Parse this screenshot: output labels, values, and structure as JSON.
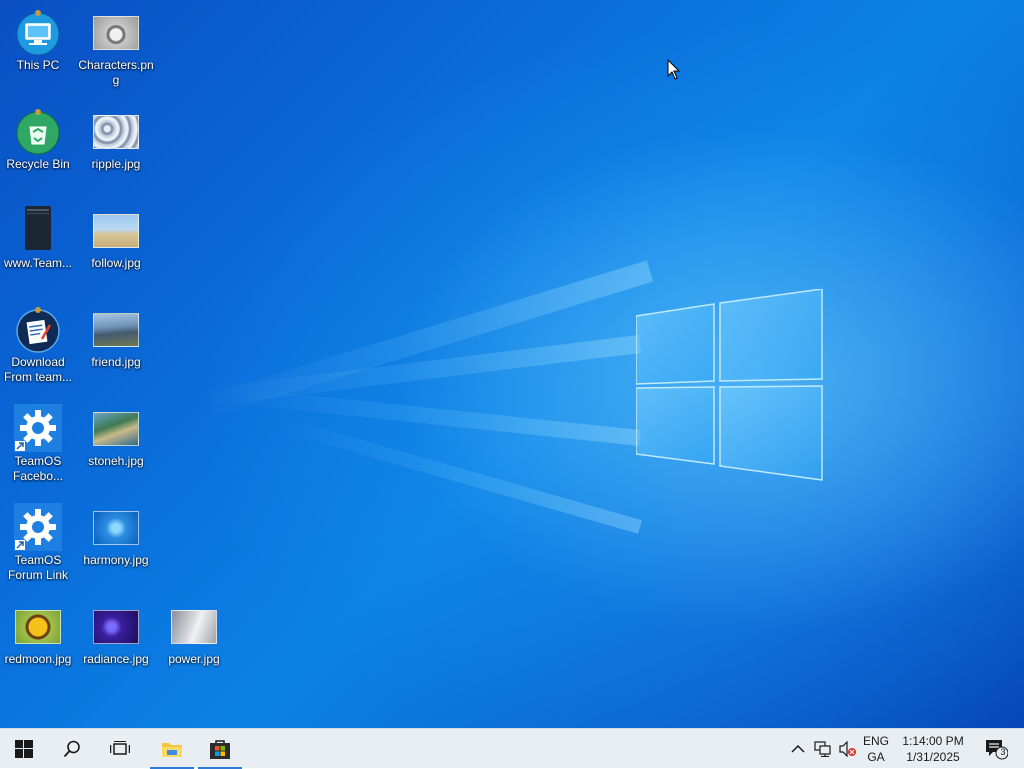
{
  "desktop": {
    "icons": [
      {
        "label": "This PC",
        "icon": "computer-icon"
      },
      {
        "label": "Characters.png",
        "icon": "image-thumbnail"
      },
      {
        "label": "Recycle Bin",
        "icon": "recycle-bin-icon"
      },
      {
        "label": "ripple.jpg",
        "icon": "image-thumbnail"
      },
      {
        "label": "www.Team...",
        "icon": "file-icon"
      },
      {
        "label": "follow.jpg",
        "icon": "image-thumbnail"
      },
      {
        "label": "Download From team...",
        "icon": "download-icon"
      },
      {
        "label": "friend.jpg",
        "icon": "image-thumbnail"
      },
      {
        "label": "TeamOS Facebo...",
        "icon": "settings-shortcut-icon"
      },
      {
        "label": "stoneh.jpg",
        "icon": "image-thumbnail"
      },
      {
        "label": "TeamOS Forum Link",
        "icon": "settings-shortcut-icon"
      },
      {
        "label": "harmony.jpg",
        "icon": "image-thumbnail"
      },
      {
        "label": "redmoon.jpg",
        "icon": "image-thumbnail"
      },
      {
        "label": "radiance.jpg",
        "icon": "image-thumbnail"
      },
      {
        "label": "power.jpg",
        "icon": "image-thumbnail"
      }
    ]
  },
  "taskbar": {
    "start_icon": "windows-start-icon",
    "search_icon": "search-icon",
    "taskview_icon": "task-view-icon",
    "pinned": [
      {
        "name": "File Explorer",
        "icon": "folder-icon"
      },
      {
        "name": "Microsoft Store",
        "icon": "store-icon"
      }
    ],
    "tray": {
      "chevron_icon": "chevron-up-icon",
      "network_icon": "network-icon",
      "volume_icon": "volume-muted-icon",
      "lang_line1": "ENG",
      "lang_line2": "GA",
      "time": "1:14:00 PM",
      "date": "1/31/2025",
      "notification_count": "3"
    }
  },
  "colors": {
    "desktop_blue": "#0a6ad8",
    "taskbar_bg": "#e9eef3",
    "accent": "#2f7ad8"
  }
}
